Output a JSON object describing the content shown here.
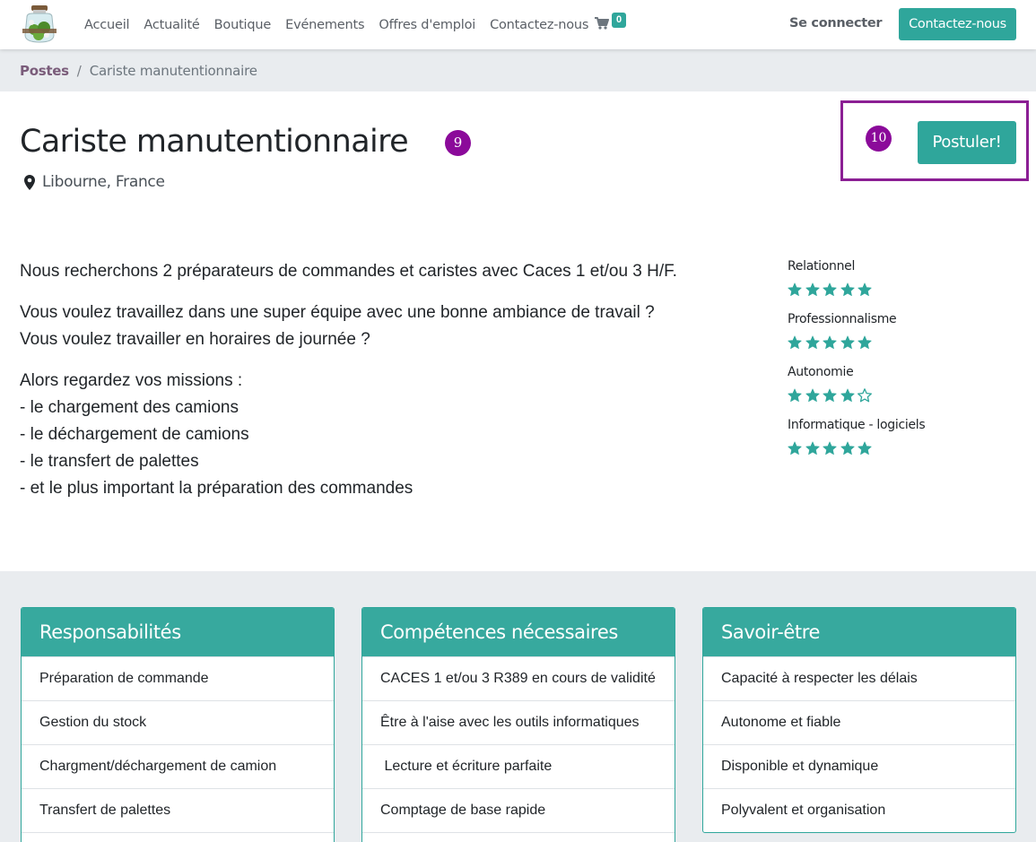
{
  "header": {
    "nav": [
      "Accueil",
      "Actualité",
      "Boutique",
      "Evénements",
      "Offres d'emploi",
      "Contactez-nous"
    ],
    "cart_count": "0",
    "signin_label": "Se connecter",
    "contact_button": "Contactez-nous",
    "brand_color": "#2fa69b"
  },
  "breadcrumb": {
    "parent": "Postes",
    "separator": "/",
    "current": "Cariste manutentionnaire"
  },
  "job": {
    "title": "Cariste manutentionnaire",
    "location": "Libourne, France",
    "apply_label": "Postuler!",
    "markers": [
      "9",
      "10"
    ]
  },
  "description": {
    "paragraphs": [
      [
        "Nous recherchons 2 préparateurs de commandes et caristes avec Caces 1 et/ou 3 H/F."
      ],
      [
        "Vous voulez travaillez dans une super équipe avec une bonne ambiance de travail ?",
        "Vous voulez travailler en horaires de journée ?"
      ],
      [
        "Alors regardez vos missions :",
        "- le chargement des camions",
        "- le déchargement de camions",
        "- le transfert de palettes",
        "- et le plus important la préparation des commandes"
      ]
    ]
  },
  "skills": [
    {
      "name": "Relationnel",
      "rating": 5,
      "max": 5
    },
    {
      "name": "Professionnalisme",
      "rating": 5,
      "max": 5
    },
    {
      "name": "Autonomie",
      "rating": 4,
      "max": 5
    },
    {
      "name": "Informatique - logiciels",
      "rating": 5,
      "max": 5
    }
  ],
  "cards": [
    {
      "title": "Responsabilités",
      "items": [
        "Préparation de commande",
        "Gestion du stock",
        "Chargment/déchargement de camion",
        "Transfert de palettes"
      ]
    },
    {
      "title": "Compétences nécessaires",
      "items": [
        "CACES 1 et/ou 3 R389 en cours de validité",
        "Être à l'aise avec les outils informatiques",
        " Lecture et écriture parfaite",
        "Comptage de base rapide"
      ]
    },
    {
      "title": "Savoir-être",
      "items": [
        "Capacité à respecter les délais",
        "Autonome et fiable",
        "Disponible et dynamique",
        "Polyvalent et organisation"
      ]
    }
  ]
}
